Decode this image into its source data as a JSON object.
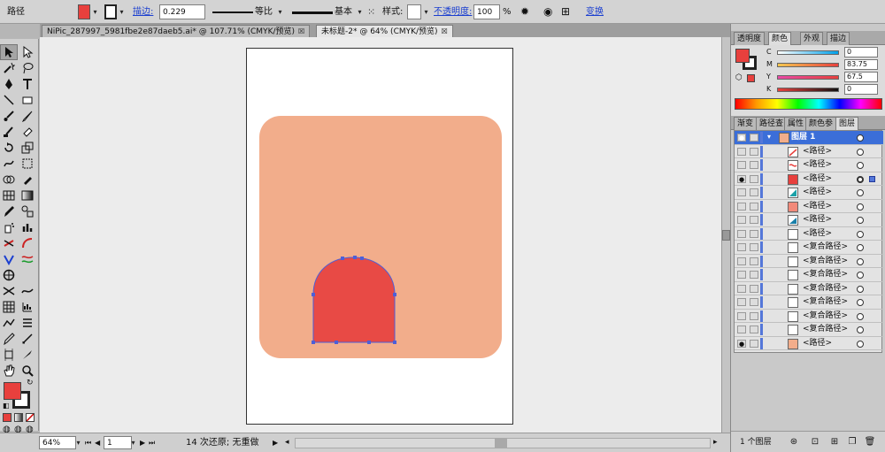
{
  "control_bar": {
    "object_type": "路径",
    "fill_color": "#e8403d",
    "stroke_label": "描边:",
    "stroke_weight": "0.229",
    "profile": "等比",
    "brush": "基本",
    "style_label": "样式:",
    "opacity_label": "不透明度:",
    "opacity_value": "100",
    "opacity_unit": "%",
    "transform_label": "变换"
  },
  "tabs": [
    {
      "label": "NiPic_287997_5981fbe2e87daeb5.ai* @ 107.71% (CMYK/预览)",
      "active": false
    },
    {
      "label": "未标题-2* @ 64% (CMYK/预览)",
      "active": true
    }
  ],
  "artwork": {
    "bg_color": "#f2ad8b",
    "arch_color": "#e84a45",
    "selection_color": "#4d5fd8"
  },
  "status_bar": {
    "zoom": "64%",
    "artboard_num": "1",
    "status_text": "14 次还原; 无重做"
  },
  "color_panel": {
    "tabs": [
      "透明度",
      "颜色",
      "外观",
      "描边"
    ],
    "active_tab": "颜色",
    "sliders": [
      {
        "label": "C",
        "value": "0",
        "gradient": "linear-gradient(to right,#fff,#00a0e9)"
      },
      {
        "label": "M",
        "value": "83.75",
        "gradient": "linear-gradient(to right,#f4c74f,#e8403d)"
      },
      {
        "label": "Y",
        "value": "67.5",
        "gradient": "linear-gradient(to right,#e84aa6,#e8403d)"
      },
      {
        "label": "K",
        "value": "0",
        "gradient": "linear-gradient(to right,#e8403d,#111)"
      }
    ]
  },
  "layers_panel": {
    "tabs": [
      "渐变",
      "路径查",
      "属性",
      "颜色参",
      "图层"
    ],
    "active_tab": "图层",
    "layer_name": "图层 1",
    "rows": [
      {
        "name": "<路径>",
        "thumb": "red-line"
      },
      {
        "name": "<路径>",
        "thumb": "red-wave"
      },
      {
        "name": "<路径>",
        "thumb": "red-fill",
        "selected": true,
        "visible": true
      },
      {
        "name": "<路径>",
        "thumb": "teal-corner"
      },
      {
        "name": "<路径>",
        "thumb": "salmon-fill"
      },
      {
        "name": "<路径>",
        "thumb": "teal-corner"
      },
      {
        "name": "<路径>",
        "thumb": "empty"
      },
      {
        "name": "<复合路径>",
        "thumb": "empty"
      },
      {
        "name": "<复合路径>",
        "thumb": "empty"
      },
      {
        "name": "<复合路径>",
        "thumb": "empty"
      },
      {
        "name": "<复合路径>",
        "thumb": "empty"
      },
      {
        "name": "<复合路径>",
        "thumb": "empty"
      },
      {
        "name": "<复合路径>",
        "thumb": "empty"
      },
      {
        "name": "<复合路径>",
        "thumb": "empty"
      },
      {
        "name": "<路径>",
        "thumb": "salmon-fill",
        "visible": true
      }
    ],
    "footer_count": "1 个图层"
  }
}
